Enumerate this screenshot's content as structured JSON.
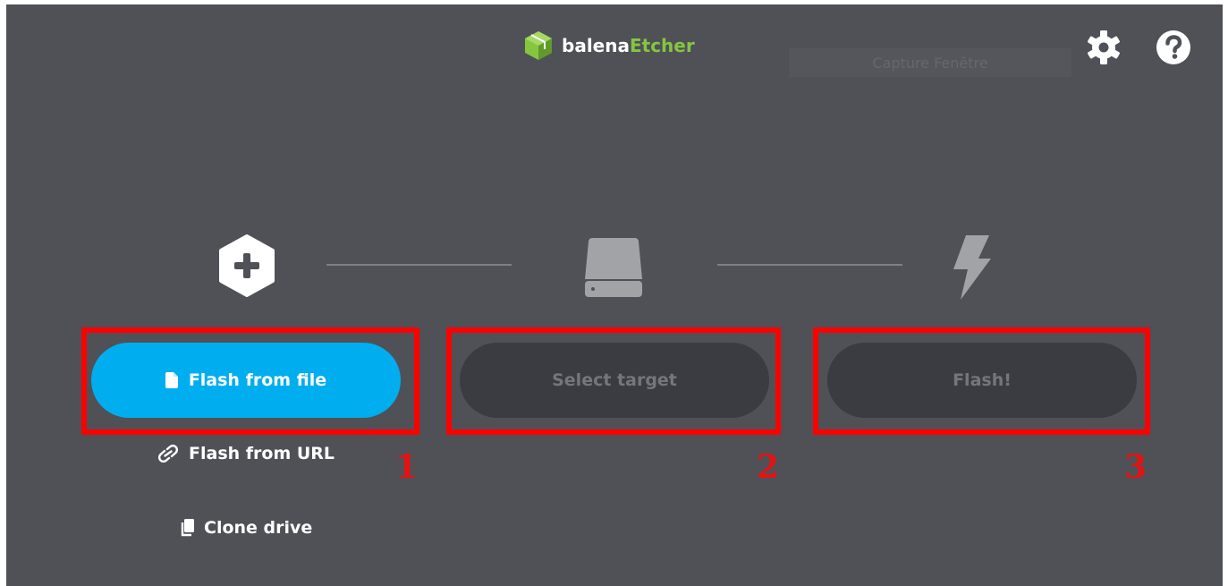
{
  "app": {
    "brand_part1": "balena",
    "brand_part2": "Etcher",
    "overlay_text": "Capture Fenêtre"
  },
  "header": {
    "settings_icon": "gear-icon",
    "help_icon": "question-icon"
  },
  "steps": [
    {
      "icon": "plus-hexagon-icon",
      "button_label": "Flash from file",
      "button_icon": "file-icon",
      "annotation": "1"
    },
    {
      "icon": "drive-icon",
      "button_label": "Select target",
      "annotation": "2"
    },
    {
      "icon": "lightning-icon",
      "button_label": "Flash!",
      "annotation": "3"
    }
  ],
  "links": {
    "flash_from_url": "Flash from URL",
    "flash_from_url_icon": "link-icon",
    "clone_drive": "Clone drive",
    "clone_drive_icon": "copy-icon"
  },
  "colors": {
    "background": "#4f5157",
    "primary": "#00aeef",
    "brand_green": "#85c540",
    "disabled_button": "#3b3c41",
    "annotation_red": "#ff0000"
  }
}
